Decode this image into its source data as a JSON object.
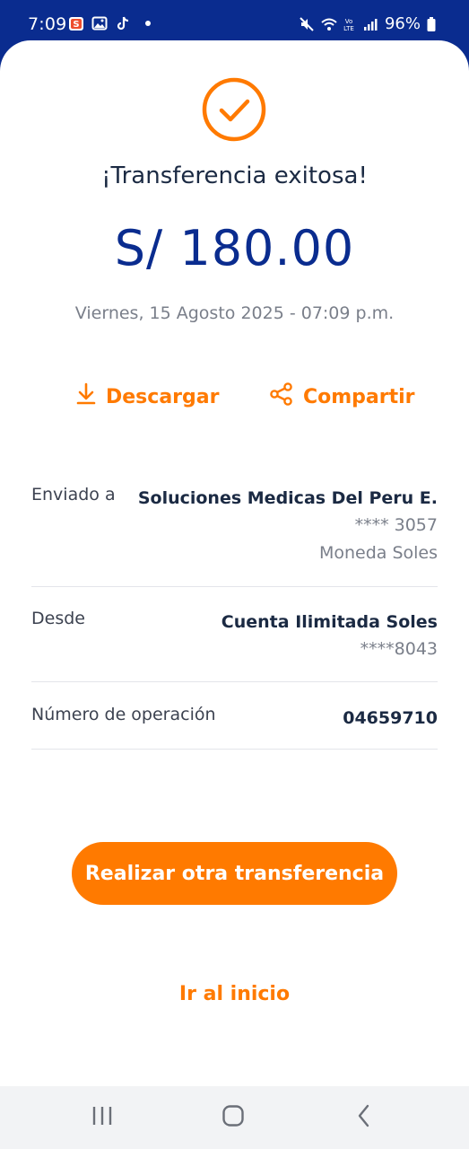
{
  "status_bar": {
    "time": "7:09",
    "battery": "96%",
    "icons": [
      "shopee-icon",
      "gallery-icon",
      "tiktok-icon",
      "notification-dot",
      "mute-icon",
      "wifi-icon",
      "volte-icon",
      "signal-icon",
      "battery-icon"
    ]
  },
  "result": {
    "title": "¡Transferencia exitosa!",
    "amount": "S/ 180.00",
    "datetime": "Viernes, 15 Agosto 2025 - 07:09 p.m."
  },
  "actions": {
    "download_label": "Descargar",
    "share_label": "Compartir"
  },
  "details": {
    "sent_to": {
      "label": "Enviado a",
      "name": "Soluciones Medicas Del Peru E.",
      "account": "**** 3057",
      "currency": "Moneda Soles"
    },
    "from": {
      "label": "Desde",
      "account_name": "Cuenta Ilimitada Soles",
      "account": "****8043"
    },
    "operation": {
      "label": "Número de operación",
      "value": "04659710"
    }
  },
  "buttons": {
    "another_transfer": "Realizar otra transferencia",
    "home": "Ir al inicio"
  },
  "colors": {
    "brand_blue": "#0a2c8f",
    "accent_orange": "#ff7a00",
    "text_dark": "#1b2a43",
    "text_muted": "#7a7f8a"
  }
}
